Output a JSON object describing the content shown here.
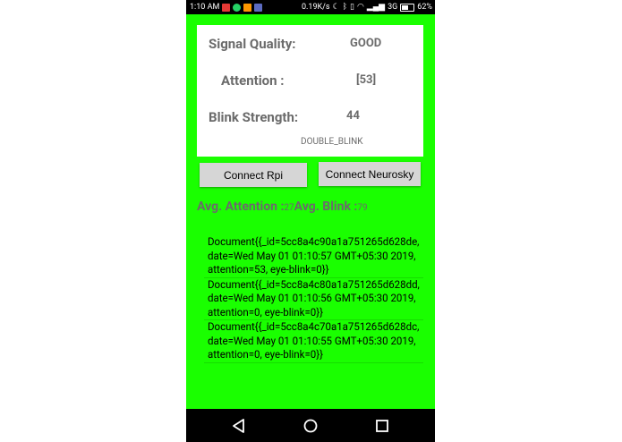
{
  "status_bar": {
    "time": "1:10 AM",
    "net_speed": "0.19K/s",
    "network": "3G",
    "battery": "62%"
  },
  "card": {
    "signal_label": "Signal Quality:",
    "signal_value": "GOOD",
    "attention_label": "Attention :",
    "attention_value": "[53]",
    "blink_label": "Blink Strength:",
    "blink_value": "44",
    "blink_event": "DOUBLE_BLINK"
  },
  "buttons": {
    "connect_rpi": "Connect Rpi",
    "connect_neurosky": "Connect Neurosky"
  },
  "averages": {
    "attention_label": "Avg. Attention :",
    "attention_value": "27",
    "blink_label": "Avg. Blink :",
    "blink_value": "79"
  },
  "records": [
    "Document{{_id=5cc8a4c90a1a751265d628de, date=Wed May 01 01:10:57 GMT+05:30 2019, attention=53, eye-blink=0}}",
    "Document{{_id=5cc8a4c80a1a751265d628dd, date=Wed May 01 01:10:56 GMT+05:30 2019, attention=0, eye-blink=0}}",
    "Document{{_id=5cc8a4c70a1a751265d628dc, date=Wed May 01 01:10:55 GMT+05:30 2019, attention=0, eye-blink=0}}"
  ],
  "icons": {
    "back": "back-icon",
    "home": "home-icon",
    "recents": "recents-icon"
  },
  "colors": {
    "screen_background": "#1aff00",
    "card_background": "#ffffff",
    "button_background": "#d6d6d6",
    "label_text": "#6b6b6b"
  }
}
